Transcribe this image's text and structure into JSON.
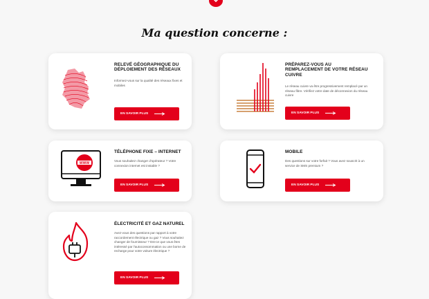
{
  "heading": "Ma question concerne :",
  "cards": [
    {
      "title": "RELEVÉ GÉOGRAPHIQUE DU DÉPLOIEMENT DES RÉSEAUX",
      "desc": "Informez-vous sur la qualité des réseaux fixes et mobiles",
      "button": "EN SAVOIR PLUS",
      "icon": "luxembourg-map-icon"
    },
    {
      "title": "PRÉPAREZ-VOUS AU REMPLACEMENT DE VOTRE RÉSEAU CUIVRE",
      "desc": "Le réseau cuivre va être progressivement remplacé par un réseau fibre. Vérifiez votre date de déconnexion du réseau cuivre",
      "button": "EN SAVOIR PLUS",
      "icon": "copper-fibre-cables-icon"
    },
    {
      "title": "TÉLÉPHONE FIXE – INTERNET",
      "desc": "Vous souhaitez changer d'opérateur ? Votre connexion internet est instable ?",
      "button": "EN SAVOIR PLUS",
      "icon": "monitor-www-icon",
      "badge": "WWW"
    },
    {
      "title": "MOBILE",
      "desc": "Des questions sur votre forfait ? Vous avez souscrit à un service de SMS premium ?",
      "button": "EN SAVOIR PLUS",
      "icon": "smartphone-check-icon"
    },
    {
      "title": "ÉLECTRICITÉ ET GAZ NATUREL",
      "desc": "Avez-vous des questions par rapport à votre raccordement électrique ou gaz ? Vous souhaitez changer de fournisseur ? Est-ce que vous êtes intéressé par l'autoconsommation ou une borne de recharge pour votre voiture électrique ?",
      "button": "EN SAVOIR PLUS",
      "icon": "flame-plug-icon"
    }
  ],
  "colors": {
    "accent": "#e3001b",
    "copper": "#c8813f"
  }
}
